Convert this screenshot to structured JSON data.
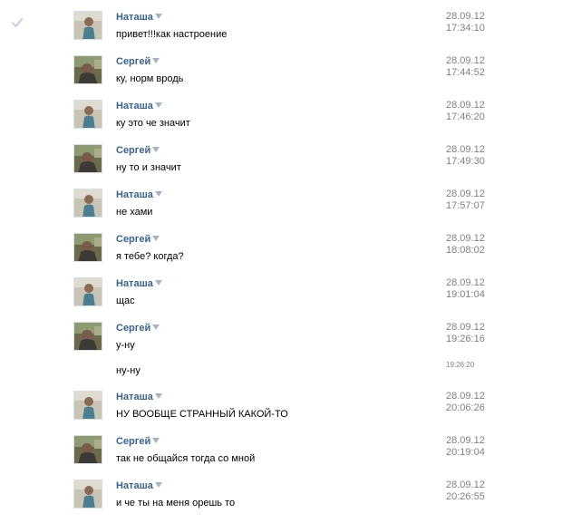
{
  "messages": [
    {
      "author": "Наташа",
      "text": "привет!!!как настроение",
      "date": "28.09.12",
      "time": "17:34:10",
      "avatar": "natasha-avatar"
    },
    {
      "author": "Сергей",
      "text": "ку, норм вродь",
      "date": "28.09.12",
      "time": "17:44:52",
      "avatar": "sergey-avatar"
    },
    {
      "author": "Наташа",
      "text": "ку это че значит",
      "date": "28.09.12",
      "time": "17:46:20",
      "avatar": "natasha-avatar"
    },
    {
      "author": "Сергей",
      "text": "ну то и значит",
      "date": "28.09.12",
      "time": "17:49:30",
      "avatar": "sergey-avatar"
    },
    {
      "author": "Наташа",
      "text": "не хами",
      "date": "28.09.12",
      "time": "17:57:07",
      "avatar": "natasha-avatar"
    },
    {
      "author": "Сергей",
      "text": "я тебе? когда?",
      "date": "28.09.12",
      "time": "18:08:02",
      "avatar": "sergey-avatar"
    },
    {
      "author": "Наташа",
      "text": "щас",
      "date": "28.09.12",
      "time": "19:01:04",
      "avatar": "natasha-avatar"
    },
    {
      "author": "Сергей",
      "text": "у-ну",
      "date": "28.09.12",
      "time": "19:26:16",
      "avatar": "sergey-avatar"
    },
    {
      "author": "Наташа",
      "text": "НУ ВООБЩЕ СТРАННЫЙ КАКОЙ-ТО",
      "date": "28.09.12",
      "time": "20:06:26",
      "avatar": "natasha-avatar"
    },
    {
      "author": "Сергей",
      "text": "так не общайся тогда со мной",
      "date": "28.09.12",
      "time": "20:19:04",
      "avatar": "sergey-avatar"
    },
    {
      "author": "Наташа",
      "text": "и че ты на меня орешь то",
      "date": "28.09.12",
      "time": "20:26:55",
      "avatar": "natasha-avatar"
    }
  ],
  "extra_message": {
    "text": "ну-ну",
    "time": "19:26:20"
  },
  "icons": {
    "check": "checkmark-icon",
    "dropdown": "dropdown-arrow-icon"
  },
  "colors": {
    "author": "#36638e",
    "timestamp": "#808080",
    "arrow": "#a6b3c2"
  }
}
